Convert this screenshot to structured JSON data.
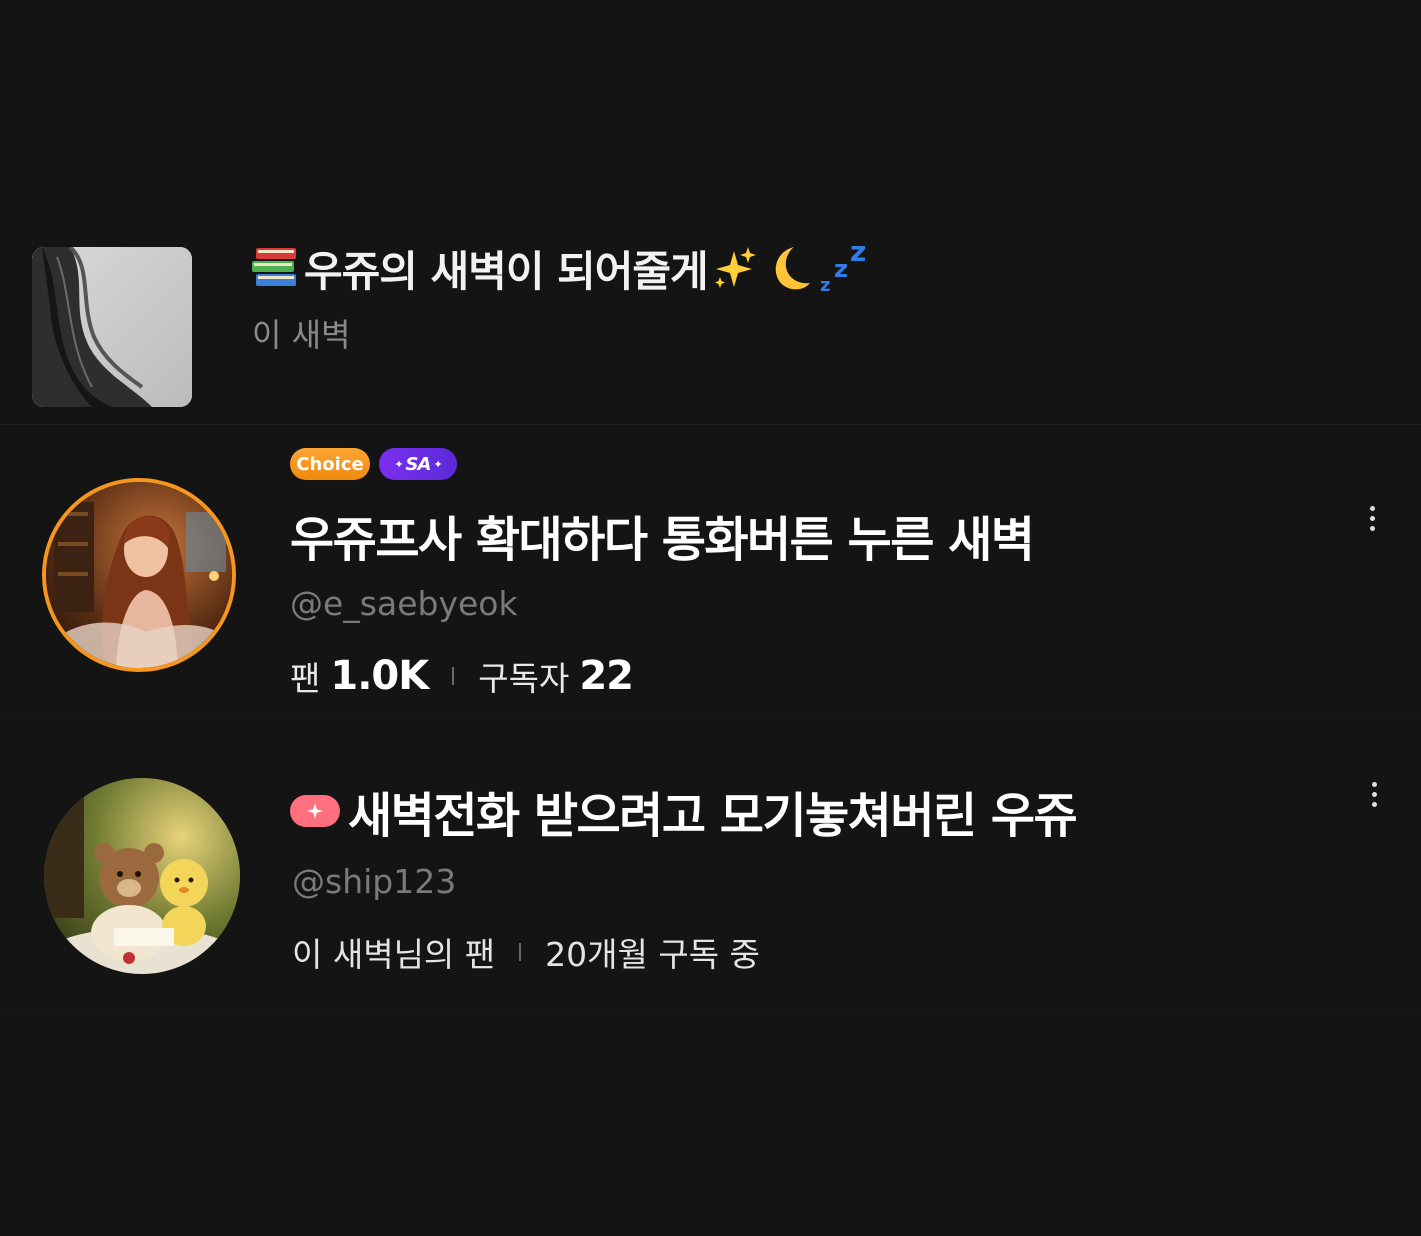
{
  "top_card": {
    "title": "우쥬의 새벽이 되어줄게",
    "subtitle": "이 새벽",
    "title_emoji_left": "books-icon",
    "title_emoji_right": [
      "sparkles-icon",
      "crescent-moon-icon",
      "zzz-icon"
    ]
  },
  "channel": {
    "badges": {
      "choice": "Choice",
      "special": "SA"
    },
    "title": "우쥬프사 확대하다 통화버튼 누른 새벽",
    "handle": "@e_saebyeok",
    "fans_label": "팬",
    "fans_value": "1.0K",
    "subs_label": "구독자",
    "subs_value": "22",
    "avatar_ring_color": "#f5961f"
  },
  "post": {
    "title": "새벽전화 받으려고 모기놓쳐버린 우쥬",
    "handle": "@ship123",
    "fan_text": "이 새벽님의 팬",
    "subscription_text": "20개월 구독 중",
    "pill_color": "#ff6f7d"
  }
}
